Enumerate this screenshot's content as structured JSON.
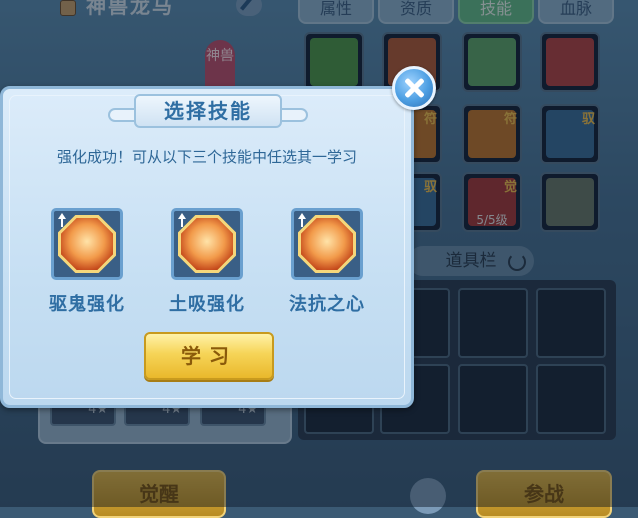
{
  "background": {
    "pet_name": "神兽龙马",
    "tabs": [
      "属性",
      "资质",
      "技能",
      "血脉"
    ],
    "active_tab": "技能",
    "god_badge": "神兽",
    "skill_grid": [
      {
        "tag": "",
        "level": "",
        "color": "#4f9a4a"
      },
      {
        "tag": "",
        "level": "",
        "color": "#b25b38"
      },
      {
        "tag": "",
        "level": "",
        "color": "#5fa86a"
      },
      {
        "tag": "",
        "level": "",
        "color": "#b54444"
      },
      {
        "tag": "符",
        "level": "",
        "color": "#c2772d"
      },
      {
        "tag": "符",
        "level": "",
        "color": "#c2772d"
      },
      {
        "tag": "驭",
        "level": "",
        "color": "#3b6f9c"
      },
      {
        "tag": "驭",
        "level": "",
        "color": "#3b6f9c"
      },
      {
        "tag": "觉",
        "level": "5/5级",
        "color": "#a63a3a"
      },
      {
        "tag": "",
        "level": "",
        "color": "#6a7a6a"
      }
    ],
    "item_bar_label": "道具栏",
    "pet_slots": [
      "4★",
      "4★",
      "4★"
    ],
    "awaken_button": "觉醒",
    "battle_button": "参战"
  },
  "dialog": {
    "title": "选择技能",
    "message": "强化成功！可从以下三个技能中任选其一学习",
    "options": [
      {
        "label": "驱鬼强化",
        "icon": "ghost-swirl-icon"
      },
      {
        "label": "土吸强化",
        "icon": "earth-absorb-icon"
      },
      {
        "label": "法抗之心",
        "icon": "magic-resist-heart-icon"
      }
    ],
    "learn_button": "学习",
    "close_icon": "close-icon"
  }
}
